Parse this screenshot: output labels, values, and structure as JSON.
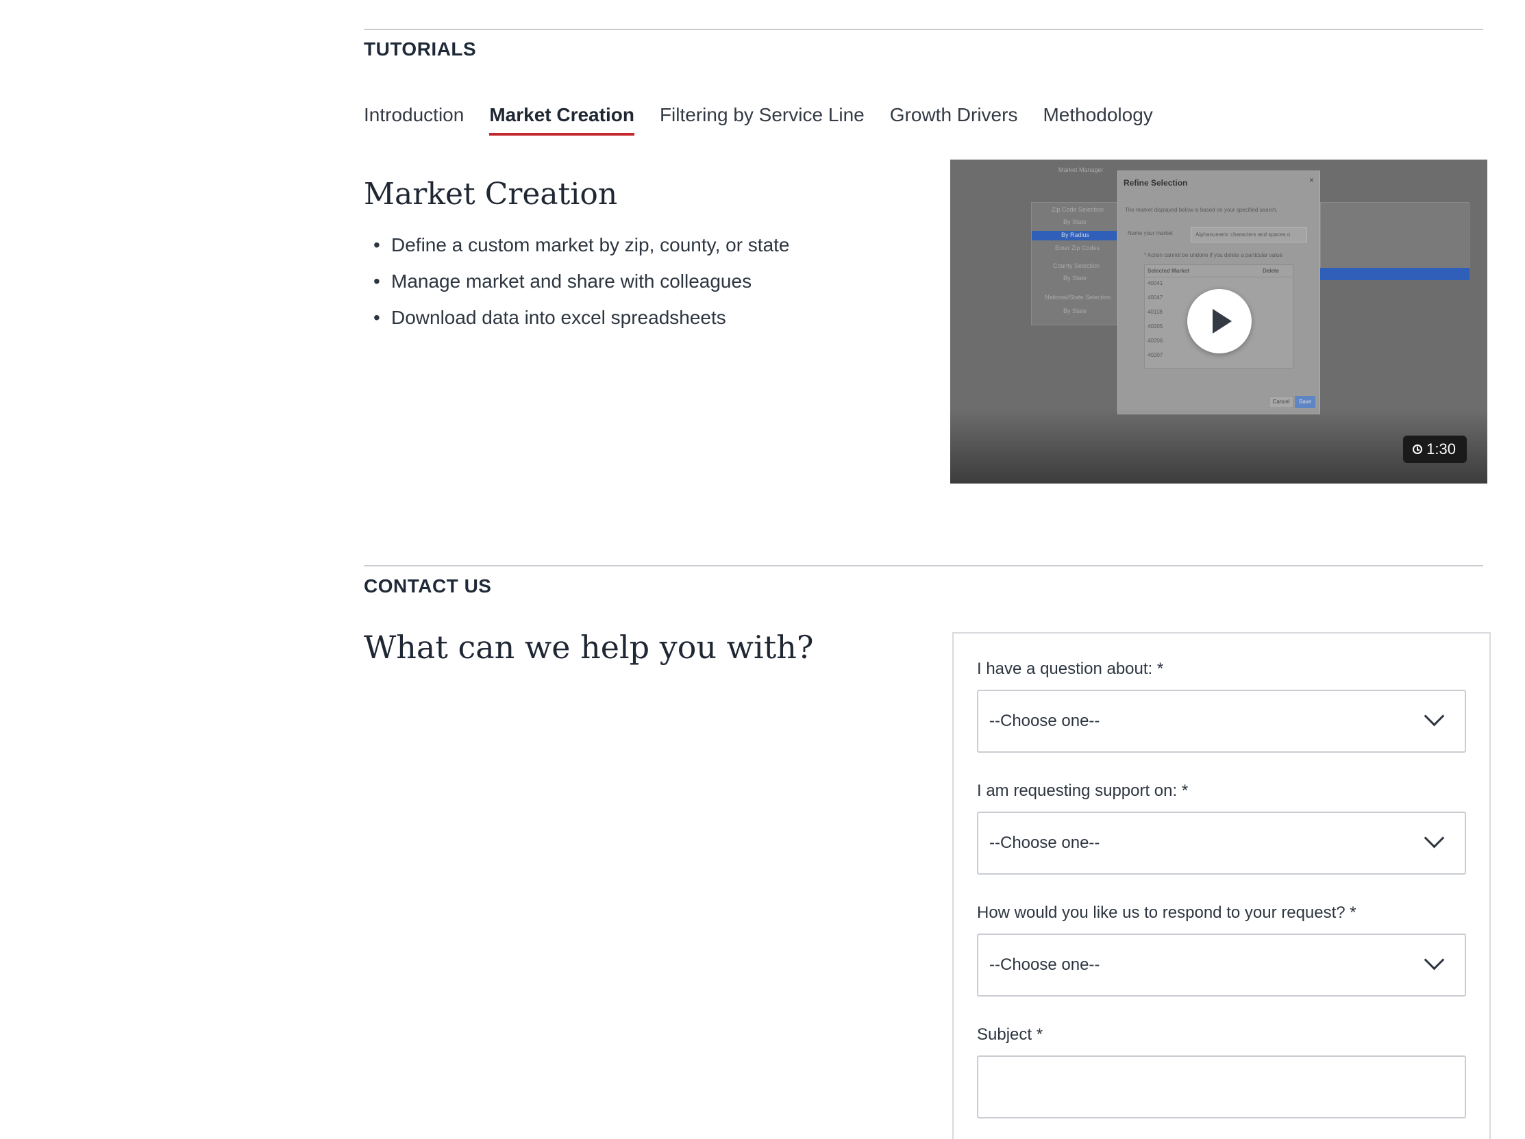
{
  "tutorials": {
    "section_label": "TUTORIALS",
    "tabs": [
      {
        "label": "Introduction",
        "active": false
      },
      {
        "label": "Market Creation",
        "active": true
      },
      {
        "label": "Filtering by Service Line",
        "active": false
      },
      {
        "label": "Growth Drivers",
        "active": false
      },
      {
        "label": "Methodology",
        "active": false
      }
    ],
    "active_panel": {
      "title": "Market Creation",
      "bullets": [
        "Define a custom market by zip, county, or state",
        "Manage market and share with colleagues",
        "Download data into excel spreadsheets"
      ]
    },
    "video": {
      "duration": "1:30",
      "thumbnail": {
        "app_title": "Market Manager",
        "modal_title": "Refine Selection",
        "modal_intro": "The market displayed below is based on your specified search.",
        "name_label": "Name your market",
        "name_placeholder": "Alphanumeric characters and spaces o",
        "warning": "* Action cannot be undone if you delete a particular value",
        "table_headers": [
          "Selected Market",
          "Delete"
        ],
        "zip_rows": [
          "40041",
          "40047",
          "40118",
          "40205",
          "40206",
          "40207"
        ],
        "cancel": "Cancel",
        "save": "Save",
        "sidebar": [
          "Zip Code Selection",
          "By State",
          "By Radius",
          "Enter Zip Codes",
          "County Selection",
          "By State",
          "National/State Selection",
          "By State"
        ]
      }
    }
  },
  "contact": {
    "section_label": "CONTACT US",
    "heading": "What can we help you with?",
    "fields": [
      {
        "label": "I have a question about: *",
        "value": "--Choose one--"
      },
      {
        "label": "I am requesting support on: *",
        "value": "--Choose one--"
      },
      {
        "label": "How would you like us to respond to your request? *",
        "value": "--Choose one--"
      }
    ],
    "subject": {
      "label": "Subject *",
      "value": ""
    }
  },
  "colors": {
    "accent_underline": "#c1272d",
    "text_dark": "#1f2733"
  }
}
